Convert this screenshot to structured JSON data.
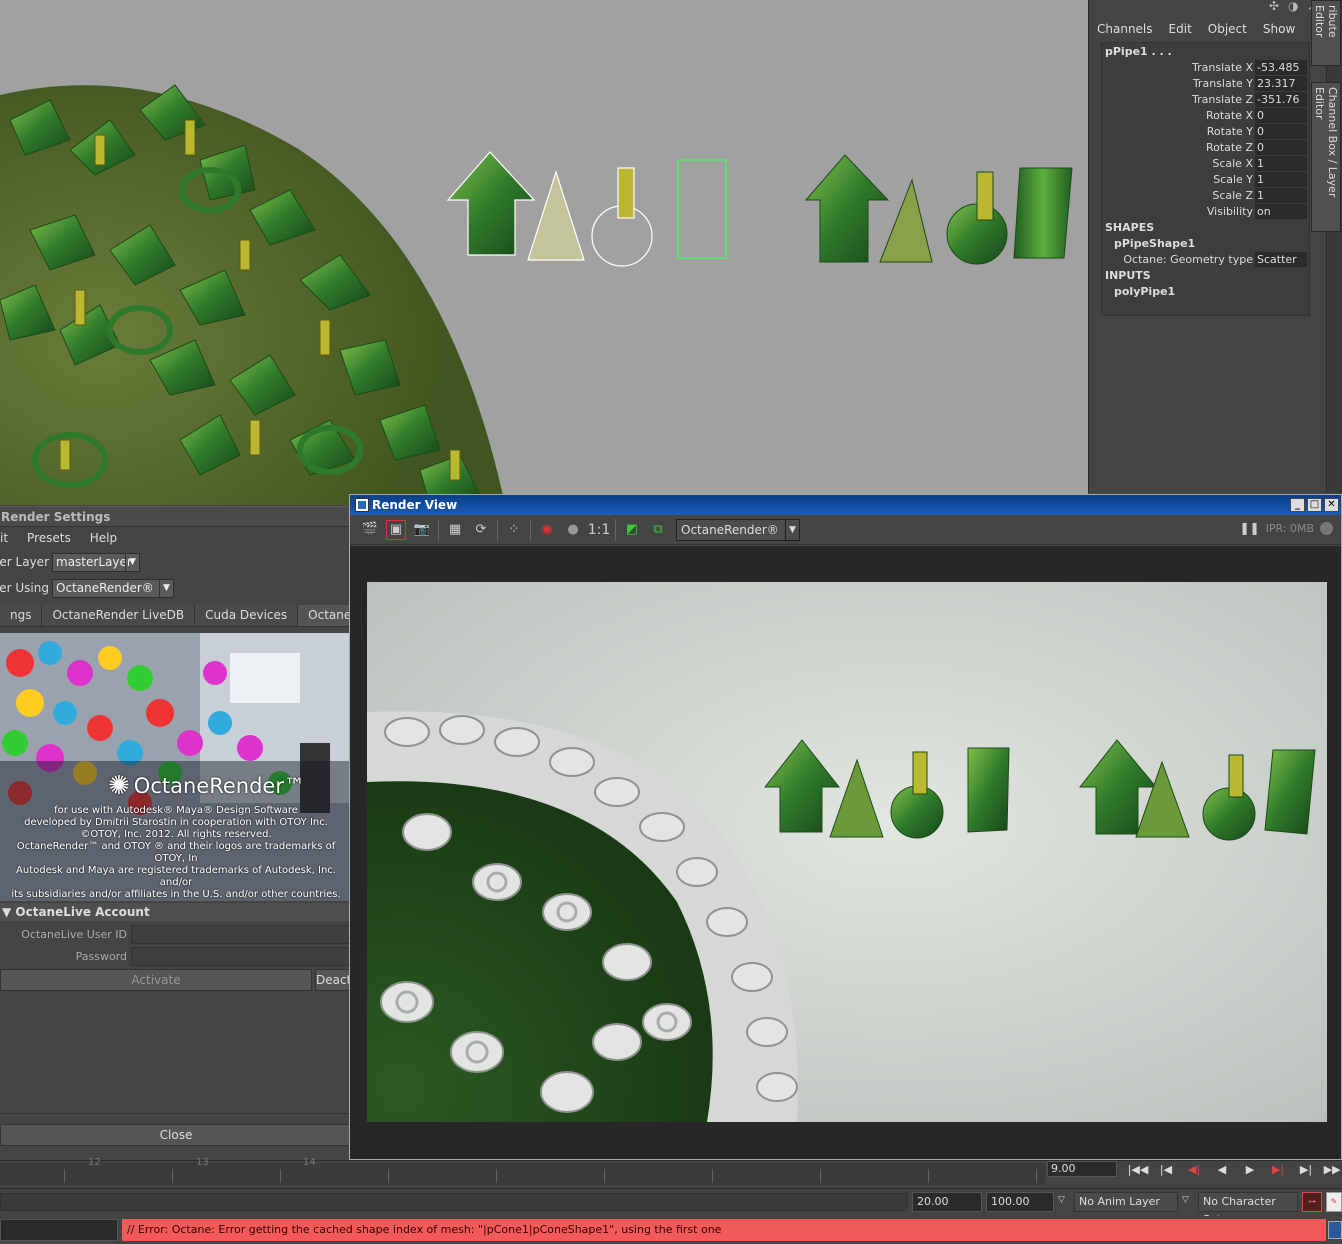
{
  "channel_box": {
    "menu": [
      "Channels",
      "Edit",
      "Object",
      "Show"
    ],
    "object_name": "pPipe1 . . .",
    "attributes": [
      {
        "label": "Translate X",
        "value": "-53.485"
      },
      {
        "label": "Translate Y",
        "value": "23.317"
      },
      {
        "label": "Translate Z",
        "value": "-351.76"
      },
      {
        "label": "Rotate X",
        "value": "0"
      },
      {
        "label": "Rotate Y",
        "value": "0"
      },
      {
        "label": "Rotate Z",
        "value": "0"
      },
      {
        "label": "Scale X",
        "value": "1"
      },
      {
        "label": "Scale Y",
        "value": "1"
      },
      {
        "label": "Scale Z",
        "value": "1"
      },
      {
        "label": "Visibility",
        "value": "on"
      }
    ],
    "shapes_header": "SHAPES",
    "shape_name": "pPipeShape1",
    "shape_attr": {
      "label": "Octane: Geometry type",
      "value": "Scatter"
    },
    "inputs_header": "INPUTS",
    "input_name": "polyPipe1",
    "side_tabs": [
      "ribute Editor",
      "Channel Box / Layer Editor"
    ]
  },
  "render_settings": {
    "title": "Render Settings",
    "menu": [
      "it",
      "Presets",
      "Help"
    ],
    "render_layer_label": "nder Layer",
    "render_layer_value": "masterLayer",
    "render_using_label": "nder Using",
    "render_using_value": "OctaneRender®",
    "tabs": [
      "ngs",
      "OctaneRender LiveDB",
      "Cuda Devices",
      "OctaneLive Accoun"
    ],
    "active_tab": 3,
    "banner": {
      "brand": "OctaneRender™",
      "credits": [
        "for use with Autodesk® Maya® Design Software",
        "developed by Dmitrii Starostin in cooperation with OTOY Inc.",
        "©OTOY, Inc. 2012. All rights reserved.",
        "OctaneRender™ and OTOY ® and their logos are trademarks of OTOY, In",
        "Autodesk and Maya are registered trademarks of Autodesk, Inc. and/or",
        "its subsidiaries and/or affiliates in the U.S. and/or other countries."
      ]
    },
    "section_title": "OctaneLive Account",
    "user_id_label": "OctaneLive User ID",
    "user_id_value": "",
    "password_label": "Password",
    "password_value": "",
    "activate_label": "Activate",
    "deactivate_label": "Deacti",
    "close_label": "Close"
  },
  "render_view": {
    "title": "Render View",
    "window_buttons": [
      "_",
      "□",
      "✕"
    ],
    "zoom_label": "1:1",
    "renderer": "OctaneRender®",
    "ipr_status": "IPR: 0MB"
  },
  "timeline": {
    "tick_labels": [
      "12",
      "13",
      "14"
    ],
    "current_frame": "9.00",
    "playback_buttons": [
      "|◀◀",
      "|◀",
      "◀|",
      "◀",
      "▶",
      "▶|",
      "▶|",
      "▶▶|"
    ]
  },
  "range": {
    "end_time": "20.00",
    "playback_end": "100.00",
    "anim_layer": "No Anim Layer",
    "character_set": "No Character Set"
  },
  "command_line": {
    "error": "// Error: Octane: Error getting the cached shape index of mesh: \"|pCone1|pConeShape1\", using the first one"
  },
  "colors": {
    "viewport_bg": "#a1a1a1",
    "error_bg": "#f25a5a",
    "title_bar": "#0a3e87",
    "foliage": "#3c8a2a"
  }
}
